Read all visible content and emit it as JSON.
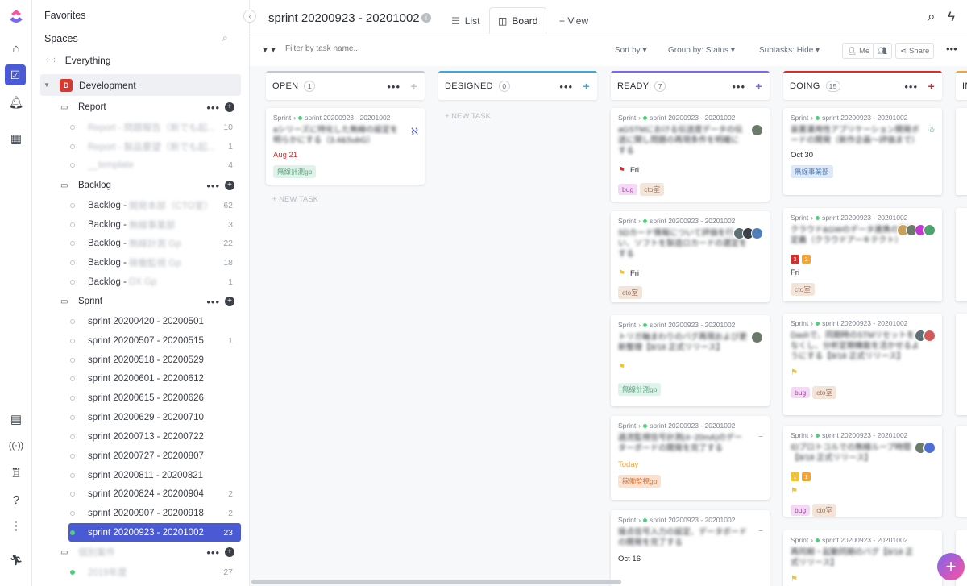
{
  "sidebar": {
    "favorites": "Favorites",
    "spaces": "Spaces",
    "everything": "Everything",
    "space_badge": "D",
    "space_name": "Development",
    "folders": [
      {
        "name": "Report",
        "lists": [
          {
            "name": "Report - 問題報告（新でも起...",
            "count": "10"
          },
          {
            "name": "Report - 製品要望（新でも起...",
            "count": "1"
          },
          {
            "name": "__template",
            "count": "4"
          }
        ]
      },
      {
        "name": "Backlog",
        "lists": [
          {
            "prefix": "Backlog - ",
            "name": "開発本部（CTO室）",
            "count": "62"
          },
          {
            "prefix": "Backlog - ",
            "name": "無線事業部",
            "count": "3"
          },
          {
            "prefix": "Backlog - ",
            "name": "無線計測 Gp",
            "count": "22"
          },
          {
            "prefix": "Backlog - ",
            "name": "稼働監視 Gp",
            "count": "18"
          },
          {
            "prefix": "Backlog - ",
            "name": "DX Gp",
            "count": "1"
          }
        ]
      },
      {
        "name": "Sprint",
        "lists": [
          {
            "name": "sprint 20200420 - 20200501",
            "count": ""
          },
          {
            "name": "sprint 20200507 - 20200515",
            "count": "1"
          },
          {
            "name": "sprint 20200518 - 20200529",
            "count": ""
          },
          {
            "name": "sprint 20200601 - 20200612",
            "count": ""
          },
          {
            "name": "sprint 20200615 - 20200626",
            "count": ""
          },
          {
            "name": "sprint 20200629 - 20200710",
            "count": ""
          },
          {
            "name": "sprint 20200713 - 20200722",
            "count": ""
          },
          {
            "name": "sprint 20200727 - 20200807",
            "count": ""
          },
          {
            "name": "sprint 20200811 - 20200821",
            "count": ""
          },
          {
            "name": "sprint 20200824 - 20200904",
            "count": "2"
          },
          {
            "name": "sprint 20200907 - 20200918",
            "count": "2"
          },
          {
            "name": "sprint 20200923 - 20201002",
            "count": "23"
          }
        ]
      },
      {
        "name": "個別案件",
        "lists": [
          {
            "name": "2019年度",
            "count": "27"
          }
        ]
      }
    ]
  },
  "header": {
    "title": "sprint 20200923 - 20201002",
    "info": "i",
    "tab_list": "List",
    "tab_board": "Board",
    "add_view": "+ View"
  },
  "toolbar": {
    "filter_placeholder": "Filter by task name...",
    "sort_by": "Sort by",
    "group_by": "Group by:",
    "group_val": "Status",
    "subtasks": "Subtasks:",
    "subtasks_val": "Hide",
    "me": "Me",
    "share": "Share"
  },
  "columns": [
    {
      "name": "OPEN",
      "count": "1",
      "color": "#c4c7cd",
      "plus_color": "#c4c7cd"
    },
    {
      "name": "DESIGNED",
      "count": "0",
      "color": "#3fa7e0",
      "plus_color": "#3fa7e0"
    },
    {
      "name": "READY",
      "count": "7",
      "color": "#7b68ee",
      "plus_color": "#7b68ee"
    },
    {
      "name": "DOING",
      "count": "15",
      "color": "#d42f2f",
      "plus_color": "#d42f2f"
    },
    {
      "name": "IN",
      "count": "",
      "color": "#f2a33a",
      "plus_color": "#f2a33a"
    }
  ],
  "crumb": {
    "sprint": "Sprint",
    "list": "sprint 20200923 - 20201002"
  },
  "cards": {
    "open": [
      {
        "title": "aシリーズに特化した無線の設定を明らかにする（3.4&SubG）",
        "date": "Aug 21",
        "tags": [
          "無線計測gp"
        ]
      }
    ],
    "ready": [
      {
        "title": "aGSTMにおける伝送度データの伝送に関し問題の再現条件を明確にする",
        "date": "Fri",
        "tags": [
          "bug",
          "cto室"
        ]
      },
      {
        "title": "SDカード情報について評価を行い、ソフトを製造ロカードの選定をする",
        "date": "Fri",
        "tags": [
          "cto室"
        ]
      },
      {
        "title": "トリガ軸まわりのバグ再現および更新整理【8/18 正式リリース】",
        "date": "",
        "tags": [
          "無線計測gp"
        ]
      },
      {
        "title": "過流監視信号計測(4~20mA)のデーターボードの開発を完了する",
        "date": "Today",
        "tags": [
          "稼働監視gp"
        ]
      },
      {
        "title": "接点信号入力の設定、データボードの開発を完了する",
        "date": "Oct 16",
        "tags": []
      }
    ],
    "doing": [
      {
        "title": "装置運用性アプリケーション開発ボードの開発（新作企画〜評価まで）",
        "date": "Oct 30",
        "tags": [
          "無線事業部"
        ]
      },
      {
        "title": "クラウド&GWのデータ連携の要件定義（クラウドアーキテクト）",
        "date": "Fri",
        "tags": [
          "cto室"
        ]
      },
      {
        "title": "Dashで、同期時のSTMリセットをなくし、分析定期機能を活かせるようにする【8/18 正式リリース】",
        "date": "",
        "tags": [
          "bug",
          "cto室"
        ]
      },
      {
        "title": "IDプロトコルでの無線ループ時間【8/18 正式リリース】",
        "date": "",
        "tags": [
          "bug",
          "cto室"
        ]
      },
      {
        "title": "再同期・起動同期のバグ【8/18 正式リリース】",
        "date": "",
        "tags": []
      }
    ]
  },
  "new_task": "+ NEW TASK",
  "prio": {
    "a": "3",
    "b": "2",
    "c": "1",
    "d": "1"
  }
}
